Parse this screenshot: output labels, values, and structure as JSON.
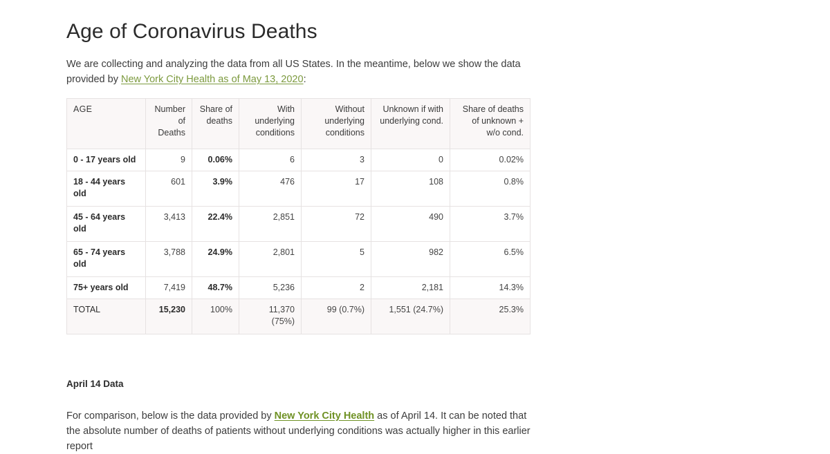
{
  "page": {
    "title": "Age of Coronavirus Deaths"
  },
  "intro": {
    "text_before": "We are collecting and analyzing the data from all US States. In the meantime, below we show the data provided by ",
    "link_label": "New York City Health as of May 13, 2020",
    "text_after": ":"
  },
  "table": {
    "headers": {
      "age": "AGE",
      "number_of_deaths": "Number of Deaths",
      "share_of_deaths": "Share of deaths",
      "with_underlying": "With underlying conditions",
      "without_underlying": "Without underlying conditions",
      "unknown_if_with": "Unknown if with underlying cond.",
      "share_unknown_wo": "Share of deaths of unknown + w/o cond."
    },
    "rows": [
      {
        "age": "0 - 17 years old",
        "number_of_deaths": "9",
        "share_of_deaths": "0.06%",
        "with_underlying": "6",
        "without_underlying": "3",
        "unknown_if_with": "0",
        "share_unknown_wo": "0.02%"
      },
      {
        "age": "18 - 44 years old",
        "number_of_deaths": "601",
        "share_of_deaths": "3.9%",
        "with_underlying": "476",
        "without_underlying": "17",
        "unknown_if_with": "108",
        "share_unknown_wo": "0.8%"
      },
      {
        "age": "45 - 64 years old",
        "number_of_deaths": "3,413",
        "share_of_deaths": "22.4%",
        "with_underlying": "2,851",
        "without_underlying": "72",
        "unknown_if_with": "490",
        "share_unknown_wo": "3.7%"
      },
      {
        "age": "65 - 74 years old",
        "number_of_deaths": "3,788",
        "share_of_deaths": "24.9%",
        "with_underlying": "2,801",
        "without_underlying": "5",
        "unknown_if_with": "982",
        "share_unknown_wo": "6.5%"
      },
      {
        "age": "75+ years old",
        "number_of_deaths": "7,419",
        "share_of_deaths": "48.7%",
        "with_underlying": "5,236",
        "without_underlying": "2",
        "unknown_if_with": "2,181",
        "share_unknown_wo": "14.3%"
      }
    ],
    "total": {
      "age": "TOTAL",
      "number_of_deaths": "15,230",
      "share_of_deaths": "100%",
      "with_underlying": "11,370 (75%)",
      "without_underlying": "99 (0.7%)",
      "unknown_if_with": "1,551 (24.7%)",
      "share_unknown_wo": "25.3%"
    }
  },
  "april_section": {
    "heading": "April 14 Data",
    "text_before": "For comparison, below is the data provided by ",
    "link_label": "New York City Health",
    "text_after": " as of April 14. It can be noted that the absolute number of deaths of patients without underlying conditions was actually higher in this earlier report"
  },
  "colors": {
    "link": "#7c9a3e",
    "link_bold": "#6f9124",
    "table_header_bg": "#faf7f7",
    "table_border": "#e6e2e2",
    "text": "#333333"
  }
}
